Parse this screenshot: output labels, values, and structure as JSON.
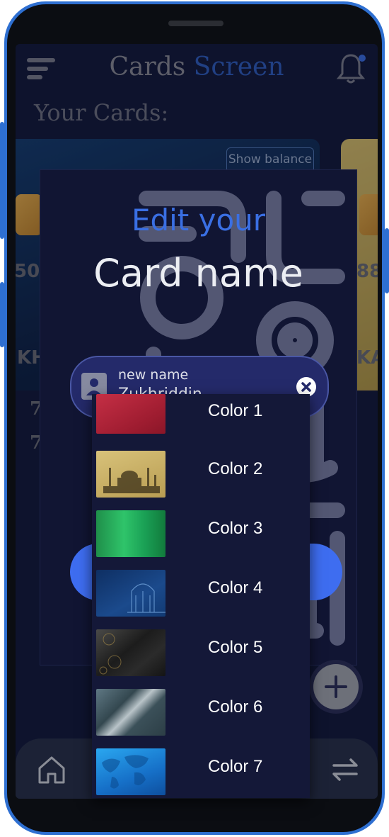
{
  "header": {
    "title_part1": "Cards ",
    "title_part2": "Screen"
  },
  "section_title": "Your Cards:",
  "background_cards": {
    "show_balance_label": "Show balance",
    "left_fragments": [
      "50",
      "KH",
      "7",
      "7"
    ],
    "right_fragments": [
      "88",
      "KA"
    ]
  },
  "modal": {
    "title_line1": "Edit your",
    "title_line2": "Card name",
    "name_field": {
      "label": "new name",
      "value": "Zukhriddin"
    }
  },
  "color_options": [
    {
      "label": "Color 1",
      "swatch": "#b5263a"
    },
    {
      "label": "Color 2",
      "swatch": "#c9b06a"
    },
    {
      "label": "Color 3",
      "swatch": "#22b35a"
    },
    {
      "label": "Color 4",
      "swatch": "#173f7a"
    },
    {
      "label": "Color 5",
      "swatch": "#2a2a2a"
    },
    {
      "label": "Color 6",
      "swatch": "#3f5560"
    },
    {
      "label": "Color 7",
      "swatch": "#1e8fe0"
    }
  ],
  "colors": {
    "accent": "#3a6fe3",
    "modal_bg": "#111533",
    "screen_bg": "#121a3a"
  },
  "icons": [
    "menu-icon",
    "bell-icon",
    "person-icon",
    "clear-icon",
    "plus-icon",
    "home-icon",
    "swap-icon"
  ]
}
